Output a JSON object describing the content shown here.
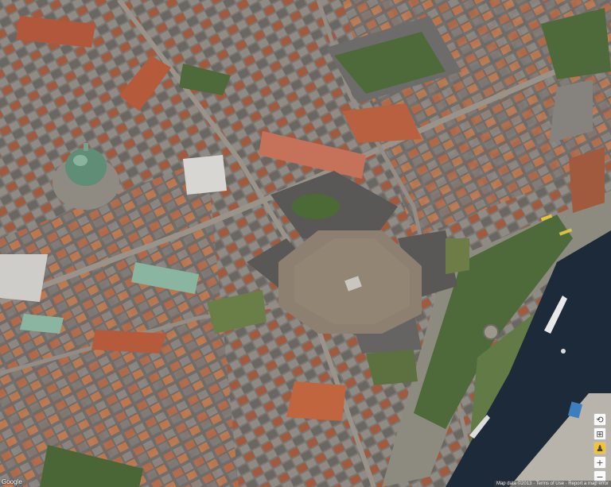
{
  "map": {
    "view": "aerial",
    "logo_text": "Google",
    "attribution": "Map data ©2013 · Terms of Use · Report a map error",
    "controls": [
      {
        "name": "rotate-button",
        "icon": "rotate-icon",
        "glyph": "⟲"
      },
      {
        "name": "tilt-button",
        "icon": "tilt-icon",
        "glyph": "⊞"
      },
      {
        "name": "pegman-button",
        "icon": "pegman-icon",
        "glyph": "♟"
      },
      {
        "name": "zoom-in-button",
        "icon": "plus-icon",
        "glyph": "+"
      },
      {
        "name": "zoom-out-button",
        "icon": "minus-icon",
        "glyph": "−"
      }
    ],
    "colors": {
      "water": "#1c2a3a",
      "plaza": "#8e8070",
      "roof_red": "#b65a3c",
      "roof_gray": "#6e6c6a",
      "dome_green": "#5f8d76",
      "grass": "#5c7040",
      "road": "#9a938a"
    }
  }
}
